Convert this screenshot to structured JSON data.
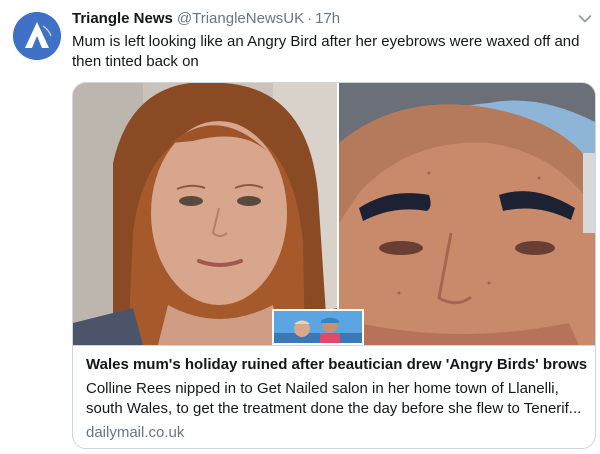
{
  "account": {
    "name": "Triangle News",
    "handle": "@TriangleNewsUK",
    "separator": "·",
    "time": "17h",
    "avatar_icon": "triangle-logo-icon",
    "avatar_color": "#3f72c4"
  },
  "tweet": {
    "text": "Mum is left looking like an Angry Bird after her eyebrows were waxed off and then tinted back on"
  },
  "card": {
    "title": "Wales mum's holiday ruined after beautician drew 'Angry Birds' brows",
    "description": "Colline Rees nipped in to Get Nailed salon in her home town of Llanelli, south Wales, to get the treatment done the day before she flew to Tenerif...",
    "domain": "dailymail.co.uk"
  },
  "icons": {
    "menu": "chevron-down-icon"
  },
  "colors": {
    "text": "#14171a",
    "muted": "#657786",
    "border": "#ccd6dd"
  }
}
